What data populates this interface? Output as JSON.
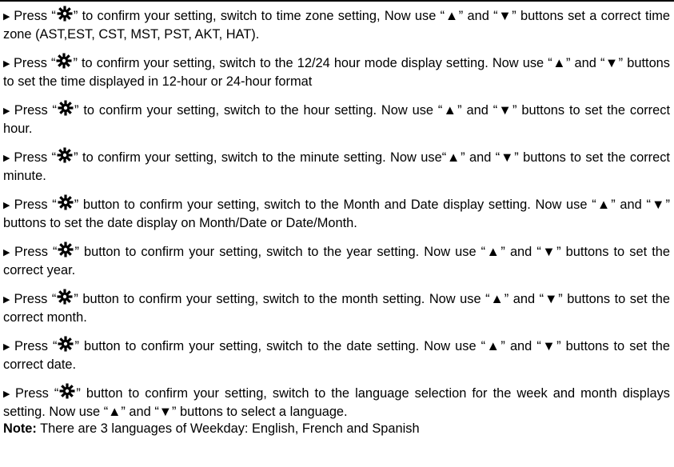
{
  "document": {
    "bullet_glyph": "▶",
    "paragraphs": [
      {
        "before": "Press “",
        "icon": "gear-icon",
        "after": "” to confirm your setting, switch to time zone setting, Now use “▲” and “▼” buttons set a correct time zone (AST,EST, CST, MST, PST, AKT, HAT)."
      },
      {
        "before": "Press “",
        "icon": "gear-icon",
        "after": "” to confirm your setting, switch to the 12/24 hour mode display setting. Now use “▲” and “▼” buttons to set the time displayed in 12-hour or 24-hour format"
      },
      {
        "before": "Press “",
        "icon": "gear-icon",
        "after": "” to confirm your setting, switch to the hour setting. Now use “▲” and “▼” buttons to set the correct hour."
      },
      {
        "before": "Press “",
        "icon": "gear-icon",
        "after": "” to confirm your setting, switch to the minute setting. Now use“▲” and “▼” buttons to set the correct minute."
      },
      {
        "before": "Press “",
        "icon": "gear-icon",
        "after": "” button to confirm your setting, switch to the Month and Date display setting. Now use “▲” and “▼” buttons to set the date display on Month/Date or Date/Month."
      },
      {
        "before": "Press “",
        "icon": "gear-icon",
        "after": "” button to confirm your setting, switch to the year setting. Now use “▲” and “▼” buttons to set the correct year."
      },
      {
        "before": "Press “",
        "icon": "gear-icon",
        "after": "” button to confirm your setting, switch to the month setting. Now use “▲” and “▼” buttons to set the correct month."
      },
      {
        "before": "Press “",
        "icon": "gear-icon",
        "after": "” button to confirm your setting, switch to the date setting. Now use “▲” and “▼” buttons to set the correct date."
      },
      {
        "before": "Press “",
        "icon": "gear-icon",
        "after": "” button to confirm your setting, switch to the language selection for the week and month displays setting. Now use “▲” and “▼” buttons to select a language."
      }
    ],
    "note": {
      "label": "Note:",
      "text": " There are 3 languages of Weekday: English, French and Spanish"
    }
  }
}
